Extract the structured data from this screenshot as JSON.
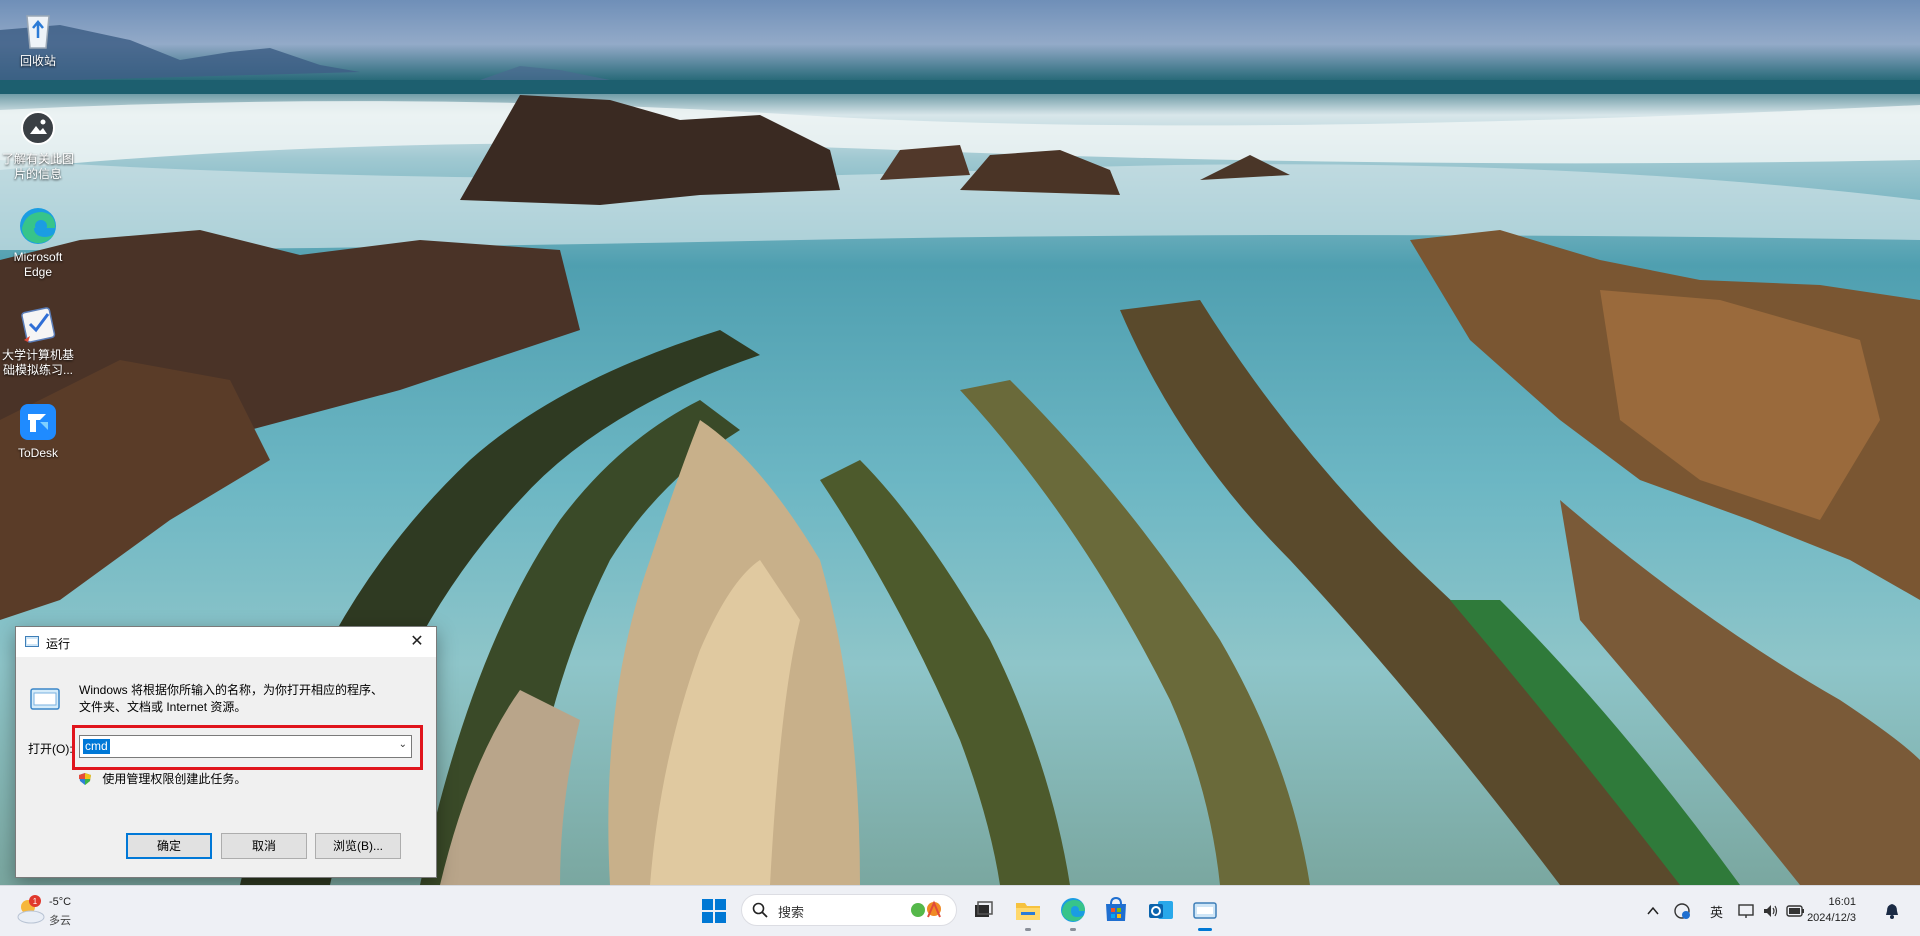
{
  "desktop": {
    "icons": [
      {
        "label": "回收站",
        "icon": "recycle-bin-icon"
      },
      {
        "label": "了解有关此图片的信息",
        "icon": "camera-info-icon"
      },
      {
        "label": "Microsoft Edge",
        "icon": "edge-icon"
      },
      {
        "label": "大学计算机基础模拟练习...",
        "icon": "exam-app-icon"
      },
      {
        "label": "ToDesk",
        "icon": "todesk-icon"
      }
    ]
  },
  "run_dialog": {
    "title": "运行",
    "close": "✕",
    "description_line1": "Windows 将根据你所输入的名称，为你打开相应的程序、",
    "description_line2": "文件夹、文档或 Internet 资源。",
    "open_label": "打开(O):",
    "open_value": "cmd",
    "admin_note": "使用管理权限创建此任务。",
    "buttons": {
      "ok": "确定",
      "cancel": "取消",
      "browse": "浏览(B)..."
    },
    "highlight_color": "#e0141c"
  },
  "taskbar": {
    "weather": {
      "temp": "-5°C",
      "condition": "多云",
      "badge": "1"
    },
    "search_placeholder": "搜索",
    "apps": [
      "file-explorer-icon",
      "edge-icon",
      "store-icon",
      "outlook-icon",
      "run-icon"
    ],
    "tray": {
      "ime": "英"
    },
    "clock": {
      "time": "16:01",
      "date": "2024/12/3"
    },
    "accent": "#0078d4"
  }
}
